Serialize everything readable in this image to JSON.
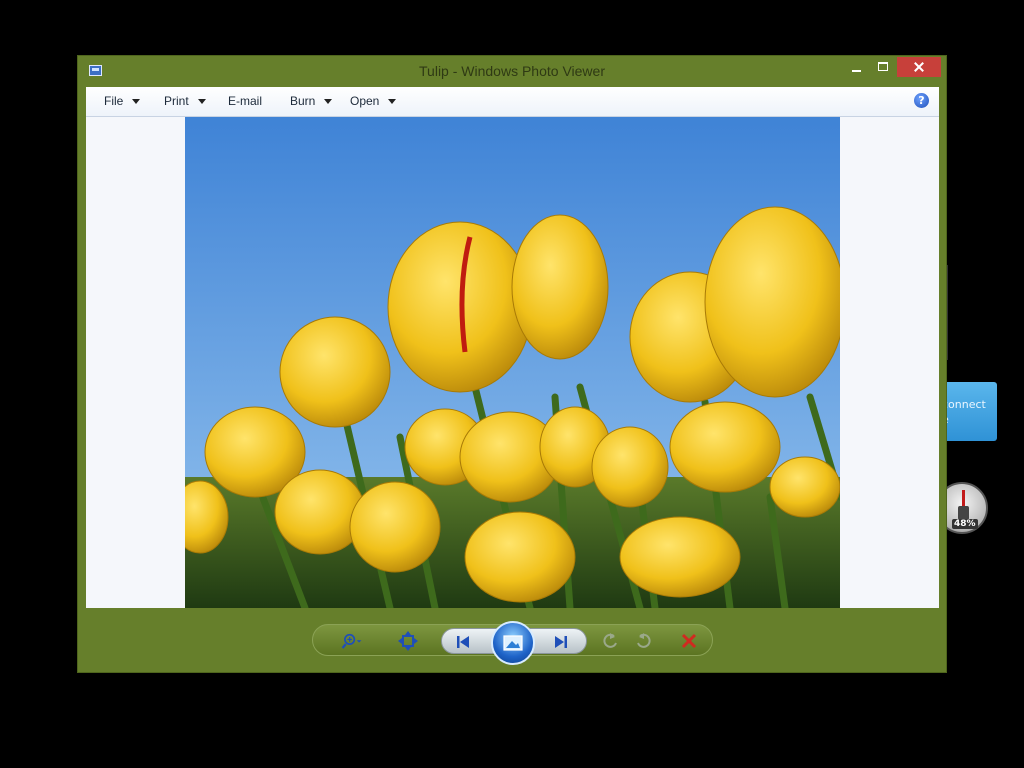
{
  "window": {
    "title": "Tulip - Windows Photo Viewer"
  },
  "menu": {
    "items": [
      {
        "label": "File",
        "has_dropdown": true
      },
      {
        "label": "Print",
        "has_dropdown": true
      },
      {
        "label": "E-mail",
        "has_dropdown": false
      },
      {
        "label": "Burn",
        "has_dropdown": true
      },
      {
        "label": "Open",
        "has_dropdown": true
      }
    ],
    "help_icon": "help-icon",
    "help_glyph": "?"
  },
  "photo": {
    "subject": "yellow tulips against blue sky"
  },
  "controls": {
    "icons": [
      "zoom-icon",
      "actual-size-icon",
      "previous-icon",
      "slideshow-icon",
      "next-icon",
      "rotate-counterclockwise-icon",
      "rotate-clockwise-icon",
      "delete-icon"
    ]
  },
  "desktop": {
    "tile_line1": "connect",
    "tile_line2": "e",
    "battery_percent": "48%"
  },
  "colors": {
    "frame": "#667f2b",
    "close": "#c7403a",
    "sky": "#4d8fd8",
    "tulip": "#f1c21c"
  }
}
